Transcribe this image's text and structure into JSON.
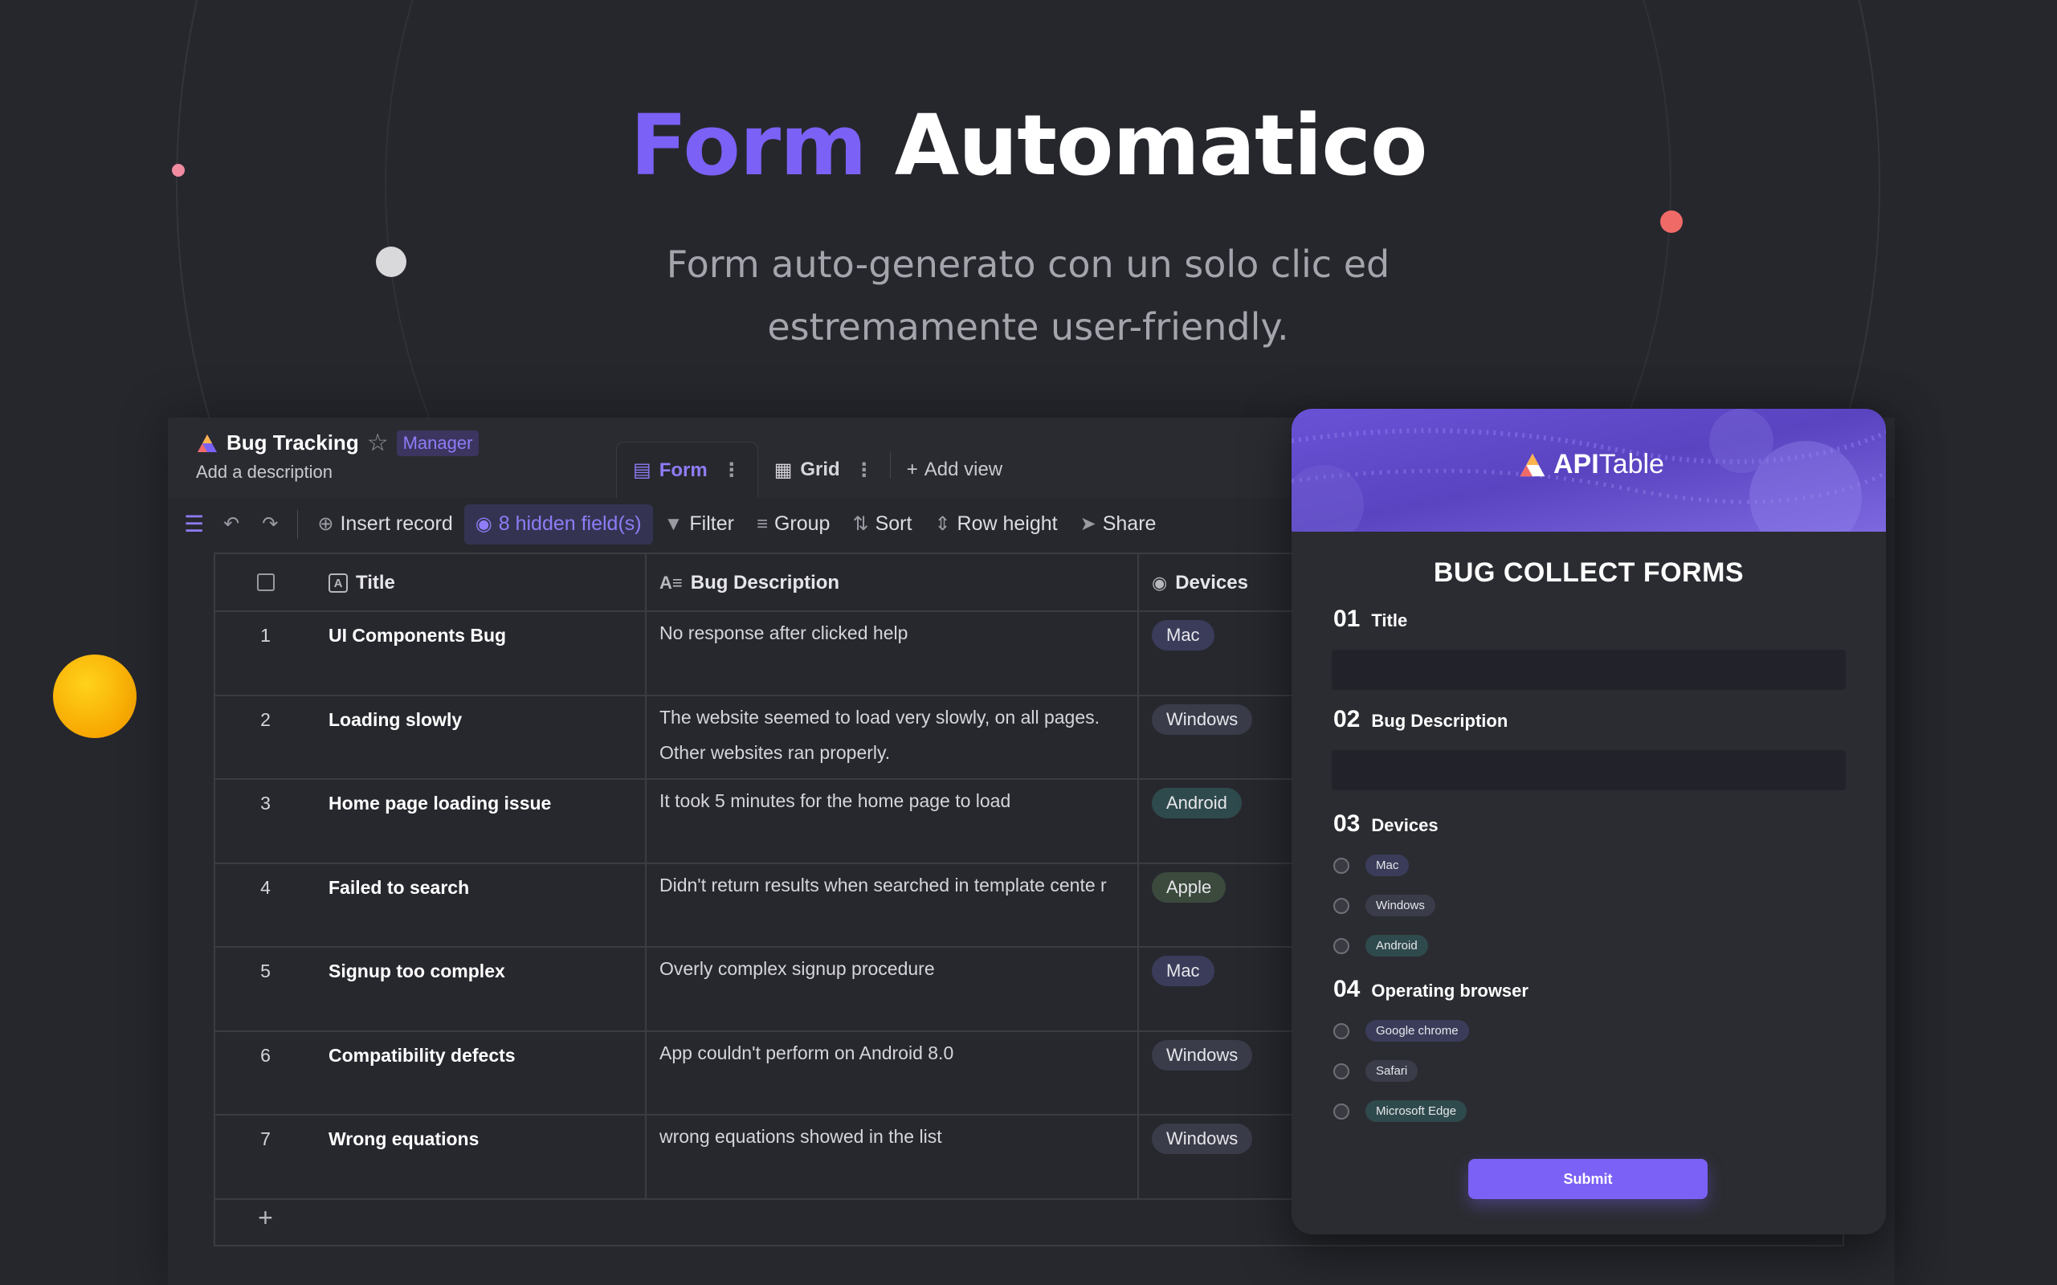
{
  "hero": {
    "title_accent": "Form",
    "title_main": "Automatico",
    "subtitle_line1": "Form auto-generato con un solo clic ed",
    "subtitle_line2": "estremamente user-friendly."
  },
  "datasheet": {
    "name": "Bug Tracking",
    "role_badge": "Manager",
    "description": "Add a description",
    "views": [
      {
        "label": "Form",
        "icon": "form-icon",
        "active": true
      },
      {
        "label": "Grid",
        "icon": "grid-icon",
        "active": false
      }
    ],
    "add_view": "Add view"
  },
  "toolbar": {
    "insert_record": "Insert record",
    "hidden_fields": "8 hidden field(s)",
    "filter": "Filter",
    "group": "Group",
    "sort": "Sort",
    "row_height": "Row height",
    "share": "Share"
  },
  "grid": {
    "columns": [
      "Title",
      "Bug Description",
      "Devices"
    ],
    "rows": [
      {
        "num": "1",
        "title": "UI Components Bug",
        "desc": "No response after clicked help",
        "device": "Mac"
      },
      {
        "num": "2",
        "title": "Loading slowly",
        "desc": "The website seemed to load very slowly, on all pages.  Other websites ran properly.",
        "device": "Windows"
      },
      {
        "num": "3",
        "title": "Home page loading issue",
        "desc": "It took 5 minutes for the home page to load",
        "device": "Android"
      },
      {
        "num": "4",
        "title": "Failed to search",
        "desc": "Didn't return results when searched in template cente r",
        "device": "Apple"
      },
      {
        "num": "5",
        "title": "Signup too complex",
        "desc": "Overly complex signup procedure",
        "device": "Mac"
      },
      {
        "num": "6",
        "title": "Compatibility defects",
        "desc": "App couldn't perform on Android 8.0",
        "device": "Windows"
      },
      {
        "num": "7",
        "title": "Wrong equations",
        "desc": "wrong equations showed in the list",
        "device": "Windows"
      }
    ],
    "add_row": "+"
  },
  "device_colors": {
    "Mac": "#3a3c5a",
    "Windows": "#3a3c4a",
    "Android": "#2f4a4d",
    "Apple": "#3b4a3d"
  },
  "form": {
    "brand_strong": "API",
    "brand_light": "Table",
    "title": "BUG COLLECT FORMS",
    "questions": [
      {
        "num": "01",
        "label": "Title"
      },
      {
        "num": "02",
        "label": "Bug Description"
      },
      {
        "num": "03",
        "label": "Devices"
      },
      {
        "num": "04",
        "label": "Operating browser"
      }
    ],
    "device_options": [
      "Mac",
      "Windows",
      "Android"
    ],
    "browser_options": [
      "Google chrome",
      "Safari",
      "Microsoft Edge"
    ],
    "submit": "Submit"
  },
  "colors": {
    "accent": "#7b61f5",
    "background": "#26272d",
    "panel": "#2b2c31"
  }
}
